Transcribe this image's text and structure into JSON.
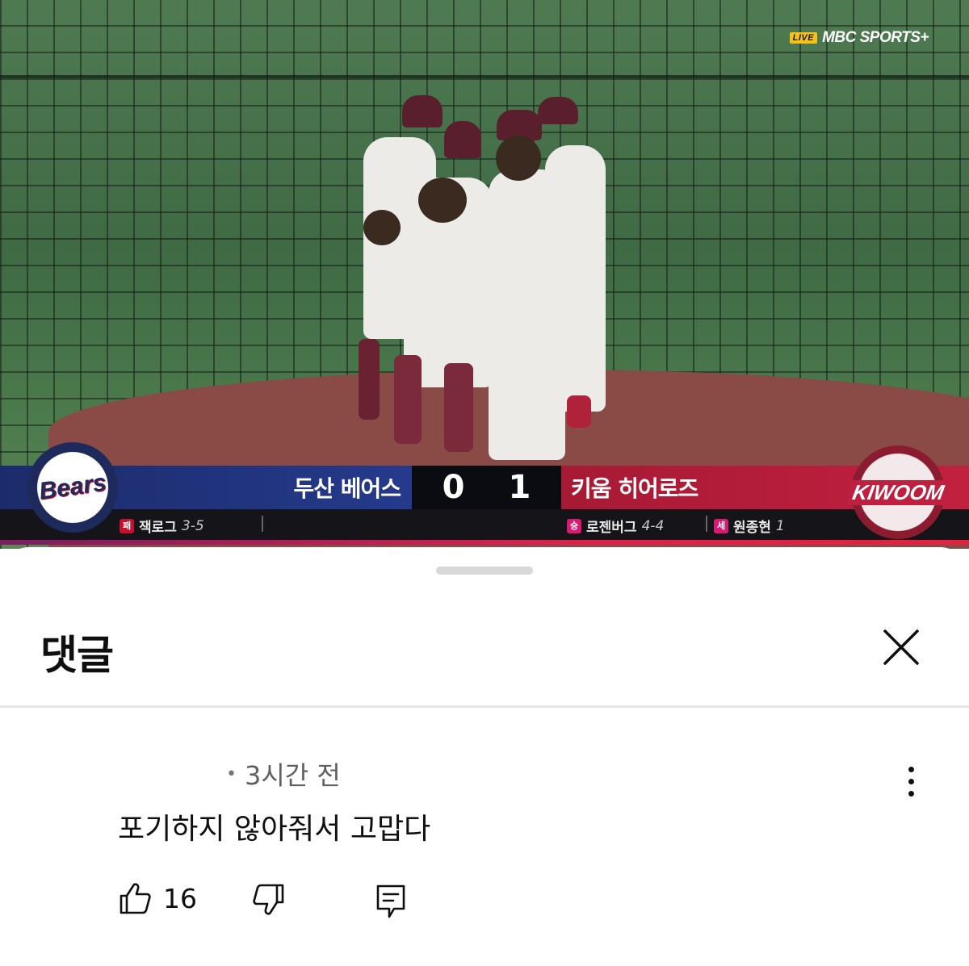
{
  "video": {
    "broadcaster": {
      "live_badge": "LIVE",
      "name": "MBC SPORTS+"
    },
    "scoreboard": {
      "away_team": {
        "name": "두산 베어스",
        "score": "0",
        "logo_text": "Bears",
        "color": "#253a8c"
      },
      "home_team": {
        "name": "키움 히어로즈",
        "score": "1",
        "logo_text": "KIWOOM",
        "color": "#c2203f"
      },
      "away_pitcher": {
        "tag": "패",
        "tag_color": "#c8102e",
        "name": "잭로그",
        "record": "3-5"
      },
      "home_pitcher": {
        "tag": "승",
        "tag_color": "#d91a72",
        "name": "로젠버그",
        "record": "4-4"
      },
      "save_pitcher": {
        "tag": "세",
        "tag_color": "#d91a72",
        "name": "원종현",
        "record": "1"
      }
    }
  },
  "comments": {
    "title": "댓글",
    "items": [
      {
        "time": "3시간 전",
        "text": "포기하지 않아줘서 고맙다",
        "likes": "16"
      }
    ]
  }
}
